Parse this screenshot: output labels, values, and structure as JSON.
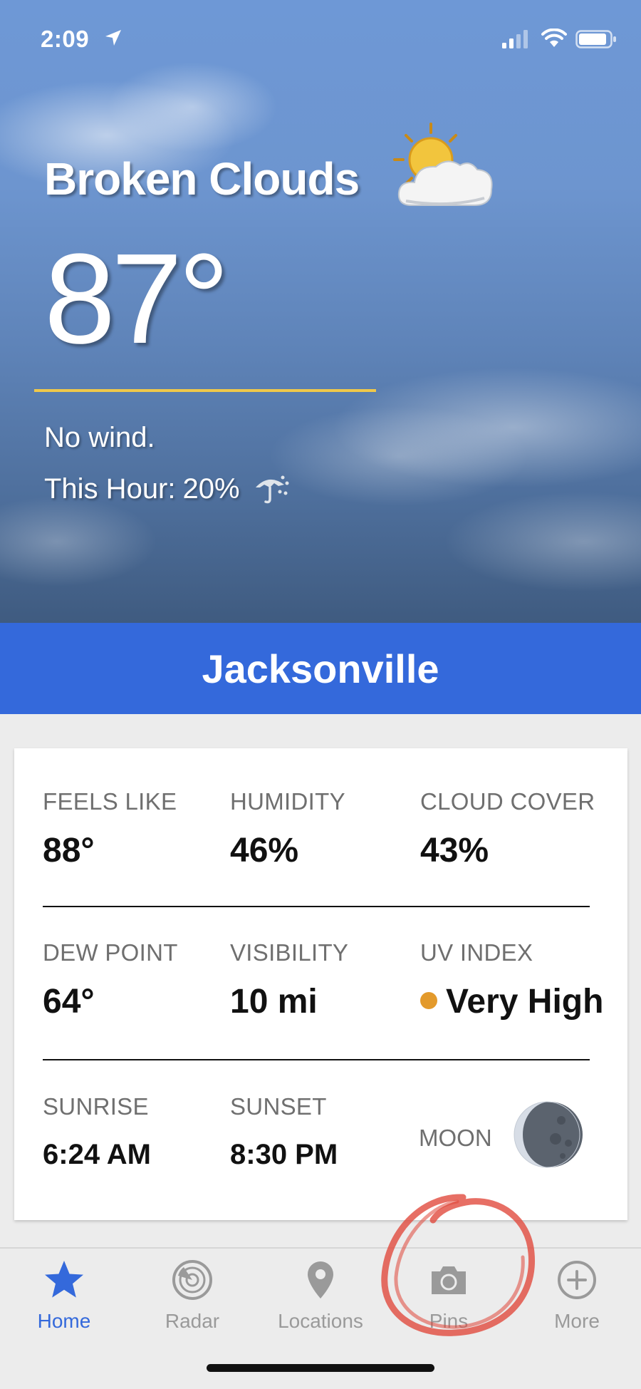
{
  "status_bar": {
    "time": "2:09"
  },
  "hero": {
    "condition": "Broken Clouds",
    "temperature": "87°",
    "wind": "No wind.",
    "precip_label": "This Hour:",
    "precip_value": "20%",
    "weather_icon": "partly-cloudy-sun-icon",
    "divider_color": "#f0c84a"
  },
  "city": {
    "name": "Jacksonville",
    "banner_color": "#3469db"
  },
  "details": {
    "feels_like": {
      "label": "FEELS LIKE",
      "value": "88°"
    },
    "humidity": {
      "label": "HUMIDITY",
      "value": "46%"
    },
    "cloud_cover": {
      "label": "CLOUD COVER",
      "value": "43%"
    },
    "dew_point": {
      "label": "DEW POINT",
      "value": "64°"
    },
    "visibility": {
      "label": "VISIBILITY",
      "value": "10 mi"
    },
    "uv_index": {
      "label": "UV INDEX",
      "value": "Very High",
      "dot_color": "#e39a2c"
    },
    "sunrise": {
      "label": "SUNRISE",
      "value": "6:24 AM"
    },
    "sunset": {
      "label": "SUNSET",
      "value": "8:30 PM"
    },
    "moon": {
      "label": "MOON",
      "icon": "moon-phase-icon"
    }
  },
  "tabs": [
    {
      "label": "Home",
      "icon": "star-icon",
      "active": true
    },
    {
      "label": "Radar",
      "icon": "radar-icon",
      "active": false
    },
    {
      "label": "Locations",
      "icon": "location-pin-icon",
      "active": false
    },
    {
      "label": "Pins",
      "icon": "camera-icon",
      "active": false
    },
    {
      "label": "More",
      "icon": "plus-circle-icon",
      "active": false
    }
  ],
  "colors": {
    "accent": "#3469db",
    "inactive_tab": "#9a9a9a",
    "annotation": "#e0473a"
  }
}
